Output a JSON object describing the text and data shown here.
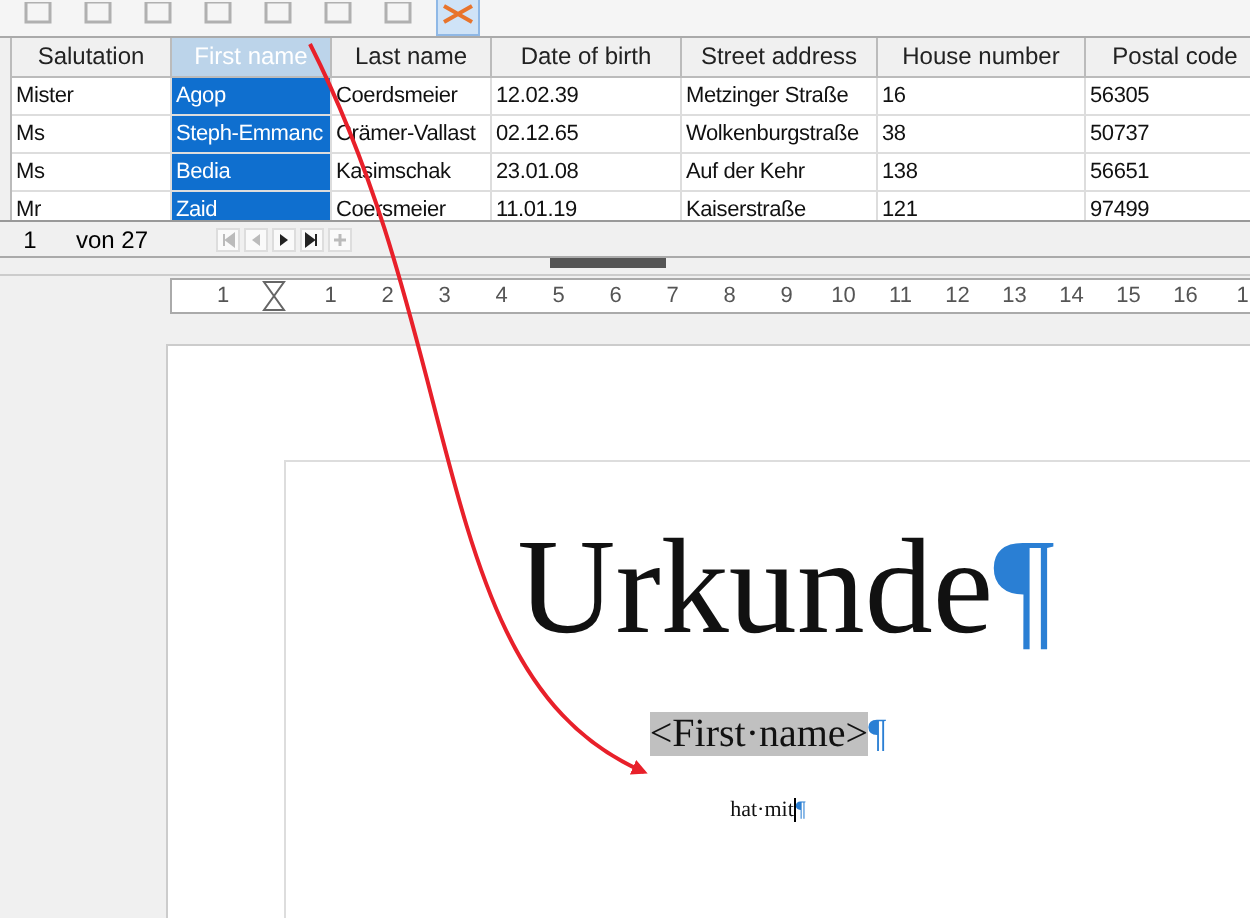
{
  "toolbar": {
    "buttons": [
      {
        "selected": false
      },
      {
        "selected": false
      },
      {
        "selected": false
      },
      {
        "selected": false
      },
      {
        "selected": false
      },
      {
        "selected": false
      },
      {
        "selected": false
      },
      {
        "selected": true
      }
    ]
  },
  "table": {
    "columns": [
      {
        "label": "Salutation",
        "selected": false
      },
      {
        "label": "First name",
        "selected": true
      },
      {
        "label": "Last name",
        "selected": false
      },
      {
        "label": "Date of birth",
        "selected": false
      },
      {
        "label": "Street address",
        "selected": false
      },
      {
        "label": "House number",
        "selected": false
      },
      {
        "label": "Postal code",
        "selected": false
      }
    ],
    "rows": [
      [
        "Mister",
        "Agop",
        "Coerdsmeier",
        "12.02.39",
        "Metzinger Straße",
        "16",
        "56305"
      ],
      [
        "Ms",
        "Steph-Emmanc",
        "Crämer-Vallast",
        "02.12.65",
        "Wolkenburgstraße",
        "38",
        "50737"
      ],
      [
        "Ms",
        "Bedia",
        "Kasimschak",
        "23.01.08",
        "Auf der Kehr",
        "138",
        "56651"
      ],
      [
        "Mr",
        "Zaid",
        "Coersmeier",
        "11.01.19",
        "Kaiserstraße",
        "121",
        "97499"
      ]
    ]
  },
  "navigation": {
    "record": "1",
    "total": "von 27"
  },
  "ruler": {
    "left_number": "1",
    "numbers": [
      "1",
      "2",
      "3",
      "4",
      "5",
      "6",
      "7",
      "8",
      "9",
      "10",
      "11",
      "12",
      "13",
      "14",
      "15",
      "16",
      "1"
    ]
  },
  "document": {
    "title": "Urkunde",
    "title_mark": "¶",
    "field": "<First·name>",
    "field_mark": "¶",
    "text": "hat·mit",
    "text_mark": "¶"
  }
}
